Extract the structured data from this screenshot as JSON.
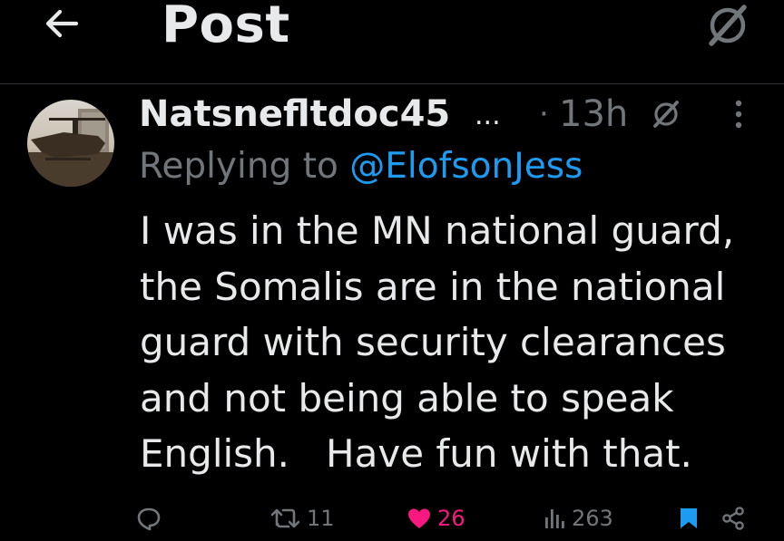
{
  "header": {
    "back_icon": "arrow-left-icon",
    "title": "Post",
    "grok_icon": "grok-icon"
  },
  "post": {
    "author_name": "Natsnefltdoc45",
    "name_ellipsis": "...",
    "separator": "·",
    "time": "13h",
    "reply_prefix": "Replying to",
    "reply_handle": "@ElofsonJess",
    "body": "I was in the MN national guard,\nthe Somalis are in the national\nguard with security clearances\nand not being able to speak\nEnglish.   Have fun with that."
  },
  "actions": {
    "reply_count": "",
    "repost_count": "11",
    "like_count": "26",
    "views_count": "263"
  },
  "colors": {
    "background": "#000000",
    "text": "#e7e9ea",
    "muted": "#71767b",
    "link": "#1d9bf0",
    "like": "#f91880",
    "bookmark": "#1d9bf0",
    "divider": "#2f3336"
  }
}
